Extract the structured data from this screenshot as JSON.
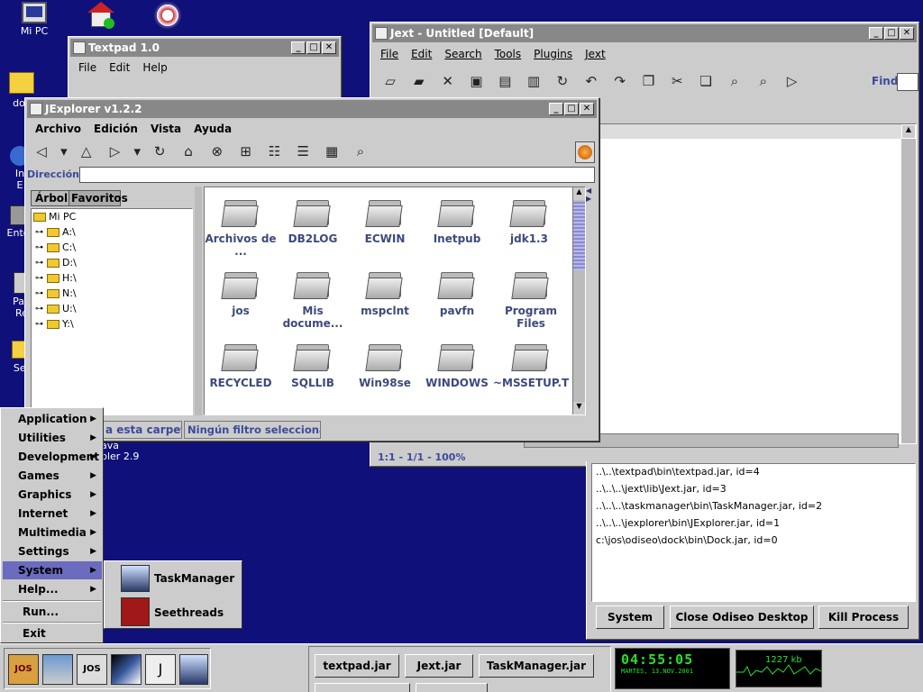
{
  "desktop": {
    "icons": [
      {
        "label": "Mi PC"
      },
      {
        "label": ""
      },
      {
        "label": ""
      },
      {
        "label": "doc"
      },
      {
        "label": "In"
      },
      {
        "label": "E"
      },
      {
        "label": "Ento"
      },
      {
        "label": "Pap"
      },
      {
        "label": "Re"
      },
      {
        "label": "Ser"
      }
    ],
    "bg_text": [
      "ava",
      "bler 2.9"
    ]
  },
  "textpad": {
    "title": "Textpad 1.0",
    "menu": [
      "File",
      "Edit",
      "Help"
    ]
  },
  "jext": {
    "title": "Jext - Untitled [Default]",
    "menu": [
      "File",
      "Edit",
      "Search",
      "Tools",
      "Plugins",
      "Jext"
    ],
    "find_label": "Find:",
    "status": "1:1 - 1/1 - 100%"
  },
  "jexplorer": {
    "title": "JExplorer v1.2.2",
    "menu": [
      "Archivo",
      "Edición",
      "Vista",
      "Ayuda"
    ],
    "address_label": "Dirección:",
    "address_value": "",
    "tabs": [
      "Árbol",
      "Favoritos"
    ],
    "tree": [
      "Mi PC",
      "A:\\",
      "C:\\",
      "D:\\",
      "H:\\",
      "N:\\",
      "U:\\",
      "Y:\\"
    ],
    "files": [
      "Archivos de ...",
      "DB2LOG",
      "ECWIN",
      "Inetpub",
      "jdk1.3",
      "jos",
      "Mis docume...",
      "mspclnt",
      "pavfn",
      "Program Files",
      "RECYCLED",
      "SQLLIB",
      "Win98se",
      "WINDOWS",
      "~MSSETUP.T"
    ],
    "status_left": "a esta carpetar",
    "status_right": "Ningún filtro seleccionado"
  },
  "taskmanager": {
    "log": [
      "..\\..\\textpad\\bin\\textpad.jar, id=4",
      "..\\..\\..\\jext\\lib\\Jext.jar, id=3",
      "..\\..\\..\\taskmanager\\bin\\TaskManager.jar, id=2",
      "..\\..\\..\\jexplorer\\bin\\JExplorer.jar, id=1",
      "c:\\jos\\odiseo\\dock\\bin\\Dock.jar, id=0"
    ],
    "buttons": [
      "System",
      "Close Odiseo Desktop",
      "Kill Process"
    ]
  },
  "start_menu": {
    "items": [
      {
        "label": "Application",
        "arrow": "▶"
      },
      {
        "label": "Utilities",
        "arrow": "▶"
      },
      {
        "label": "Development",
        "arrow": "▶"
      },
      {
        "label": "Games",
        "arrow": "▶"
      },
      {
        "label": "Graphics",
        "arrow": "▶"
      },
      {
        "label": "Internet",
        "arrow": "▶"
      },
      {
        "label": "Multimedia",
        "arrow": "▶"
      },
      {
        "label": "Settings",
        "arrow": "▶"
      },
      {
        "label": "System",
        "arrow": "▶"
      },
      {
        "label": "Help...",
        "arrow": "▶"
      },
      {
        "label": "Run...",
        "arrow": ""
      },
      {
        "label": "Exit",
        "arrow": ""
      }
    ],
    "submenu": [
      "TaskManager",
      "Seethreads"
    ]
  },
  "taskbar": {
    "tasks": [
      "textpad.jar",
      "Jext.jar",
      "TaskManager.jar"
    ],
    "clock_time": "04:55:05",
    "clock_date": "MARTES, 13.NOV.2001",
    "memory": "1227 kb",
    "dock_labels": [
      "JOS",
      "",
      "JOS",
      "",
      "",
      ""
    ]
  },
  "colors": {
    "desktop": "#10107b",
    "menu_selected": "#6b6bbf",
    "clock_green": "#28e028"
  }
}
